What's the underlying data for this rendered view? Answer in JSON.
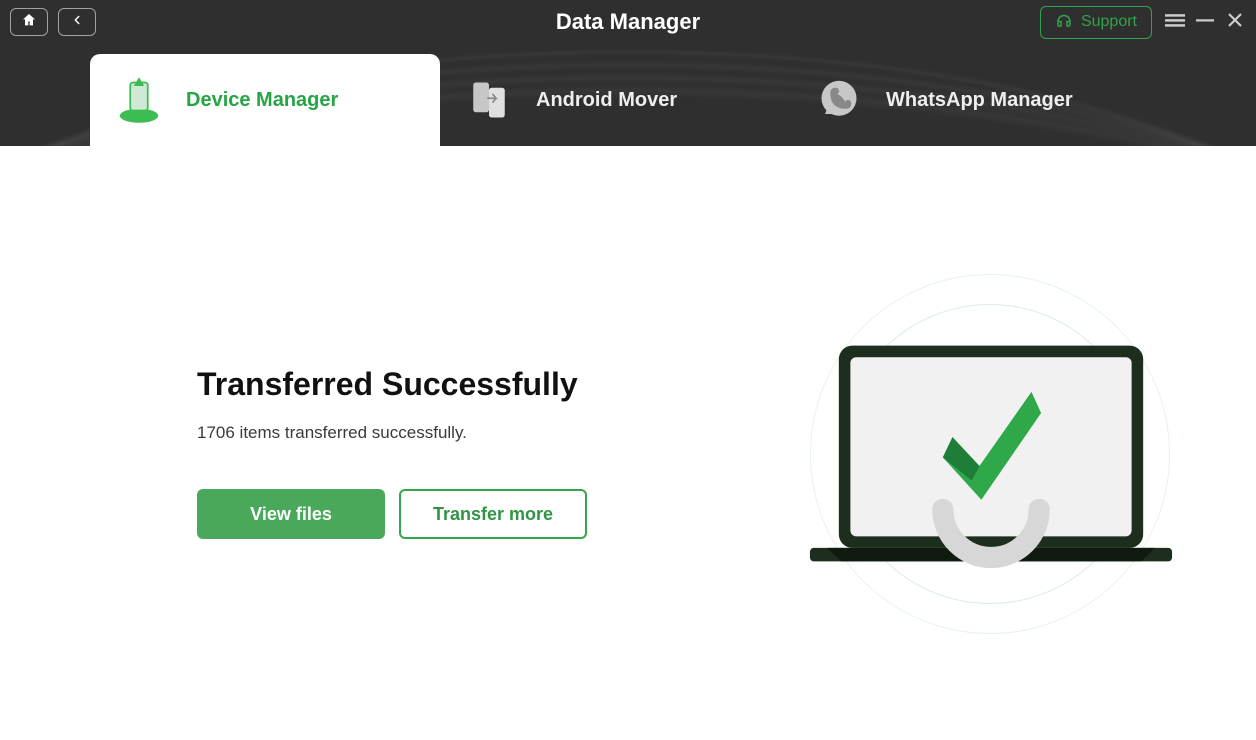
{
  "app": {
    "title": "Data Manager",
    "support_label": "Support"
  },
  "tabs": [
    {
      "label": "Device Manager",
      "icon": "device-manager-icon"
    },
    {
      "label": "Android Mover",
      "icon": "android-mover-icon"
    },
    {
      "label": "WhatsApp Manager",
      "icon": "whatsapp-manager-icon"
    }
  ],
  "main": {
    "heading": "Transferred Successfully",
    "subtext": "1706 items transferred successfully.",
    "buttons": {
      "view_files": "View files",
      "transfer_more": "Transfer more"
    }
  },
  "colors": {
    "accent": "#34a64c",
    "accent_dark": "#2f9443",
    "header_bg": "#2f2f2f"
  }
}
